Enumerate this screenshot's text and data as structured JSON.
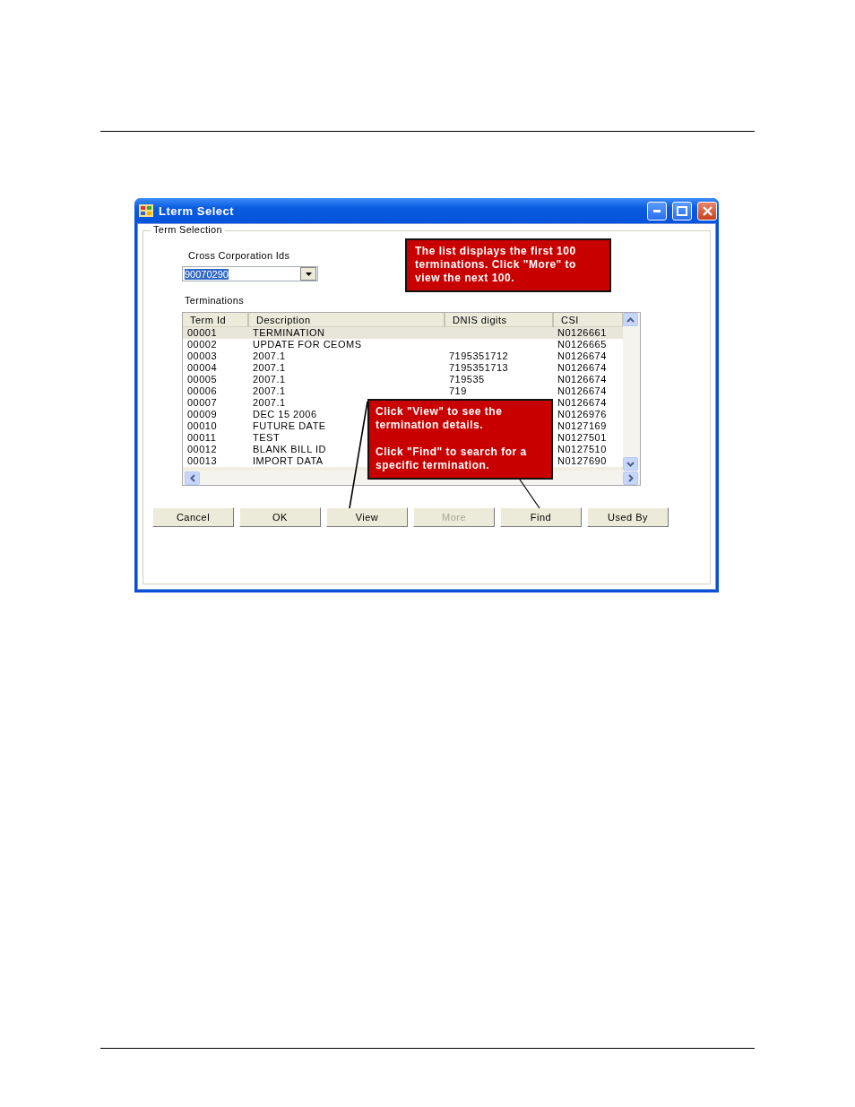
{
  "window": {
    "title": "Lterm Select"
  },
  "group_label": "Term Selection",
  "cross_corporation": {
    "label": "Cross Corporation Ids",
    "value": "90070290",
    "value_selected": true
  },
  "terminations_label": "Terminations",
  "table": {
    "columns": [
      "Term Id",
      "Description",
      "DNIS digits",
      "CSI"
    ],
    "rows": [
      {
        "term_id": "00001",
        "description": "TERMINATION",
        "csi": "N0126661",
        "selected": true
      },
      {
        "term_id": "00002",
        "description": "UPDATE FOR CEOMS",
        "csi": "N0126665",
        "selected": false
      },
      {
        "term_id": "00003",
        "description": "2007.1",
        "dnis": "7195351712",
        "csi": "N0126674",
        "selected": false
      },
      {
        "term_id": "00004",
        "description": "2007.1",
        "dnis": "7195351713",
        "csi": "N0126674",
        "selected": false
      },
      {
        "term_id": "00005",
        "description": "2007.1",
        "dnis": "719535",
        "csi": "N0126674",
        "selected": false
      },
      {
        "term_id": "00006",
        "description": "2007.1",
        "dnis": "719",
        "csi": "N0126674",
        "selected": false
      },
      {
        "term_id": "00007",
        "description": "2007.1",
        "csi": "N0126674",
        "selected": false
      },
      {
        "term_id": "00009",
        "description": "DEC 15 2006",
        "csi": "N0126976",
        "selected": false
      },
      {
        "term_id": "00010",
        "description": "FUTURE DATE",
        "csi": "N0127169",
        "selected": false
      },
      {
        "term_id": "00011",
        "description": "TEST",
        "csi": "N0127501",
        "selected": false
      },
      {
        "term_id": "00012",
        "description": "BLANK BILL ID",
        "csi": "N0127510",
        "selected": false
      },
      {
        "term_id": "00013",
        "description": "IMPORT DATA",
        "csi": "N0127690",
        "selected": false
      }
    ]
  },
  "buttons": [
    {
      "label": "Cancel",
      "disabled": false
    },
    {
      "label": "OK",
      "disabled": false
    },
    {
      "label": "View",
      "disabled": false
    },
    {
      "label": "More",
      "disabled": true
    },
    {
      "label": "Find",
      "disabled": false
    },
    {
      "label": "Used By",
      "disabled": false
    }
  ],
  "callouts": [
    {
      "paragraphs": [
        "The list displays the first 100 terminations. Click \"More\" to view the next 100."
      ]
    },
    {
      "paragraphs": [
        "Click \"View\" to see the termination details.",
        "Click \"Find\" to search for a specific termination."
      ]
    }
  ]
}
